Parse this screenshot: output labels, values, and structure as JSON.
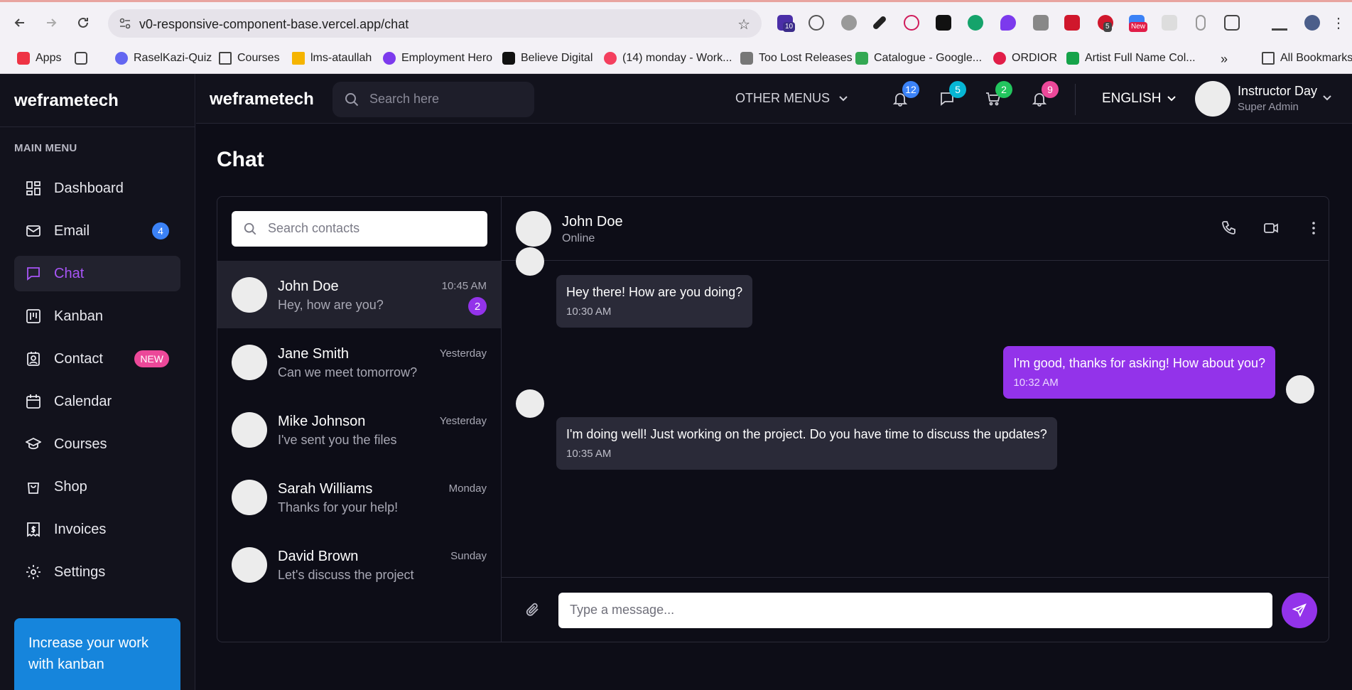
{
  "browser": {
    "url": "v0-responsive-component-base.vercel.app/chat",
    "extension_badges": [
      "10",
      "5",
      "New"
    ],
    "bookmarks": [
      "Apps",
      "RaselKazi-Quiz",
      "Courses",
      "lms-ataullah",
      "Employment Hero",
      "Believe Digital",
      "(14) monday - Work...",
      "Too Lost Releases",
      "Catalogue - Google...",
      "ORDIOR",
      "Artist Full Name Col..."
    ],
    "all_bookmarks": "All Bookmarks",
    "overflow": "»"
  },
  "sidebar": {
    "brand": "weframetech",
    "menu_title": "MAIN MENU",
    "items": [
      {
        "label": "Dashboard",
        "icon": "dashboard-icon"
      },
      {
        "label": "Email",
        "icon": "mail-icon",
        "badge": "4"
      },
      {
        "label": "Chat",
        "icon": "chat-icon",
        "active": true
      },
      {
        "label": "Kanban",
        "icon": "kanban-icon"
      },
      {
        "label": "Contact",
        "icon": "contact-icon",
        "tag": "NEW"
      },
      {
        "label": "Calendar",
        "icon": "calendar-icon"
      },
      {
        "label": "Courses",
        "icon": "graduation-cap-icon"
      },
      {
        "label": "Shop",
        "icon": "shopping-bag-icon"
      },
      {
        "label": "Invoices",
        "icon": "invoice-icon"
      },
      {
        "label": "Settings",
        "icon": "gear-icon"
      }
    ],
    "promo_text": "Increase your work with kanban"
  },
  "header": {
    "brand": "weframetech",
    "search_placeholder": "Search here",
    "other_menus": "OTHER MENUS",
    "badges": {
      "notifications": "12",
      "messages": "5",
      "cart": "2",
      "alerts": "9"
    },
    "badge_colors": {
      "notifications": "#3b82f6",
      "messages": "#06b6d4",
      "cart": "#22c55e",
      "alerts": "#ec4899"
    },
    "language": "ENGLISH",
    "user_name": "Instructor Day",
    "user_role": "Super Admin"
  },
  "page": {
    "title": "Chat"
  },
  "contacts": {
    "search_placeholder": "Search contacts",
    "list": [
      {
        "name": "John Doe",
        "message": "Hey, how are you?",
        "time": "10:45 AM",
        "unread": "2",
        "active": true
      },
      {
        "name": "Jane Smith",
        "message": "Can we meet tomorrow?",
        "time": "Yesterday"
      },
      {
        "name": "Mike Johnson",
        "message": "I've sent you the files",
        "time": "Yesterday"
      },
      {
        "name": "Sarah Williams",
        "message": "Thanks for your help!",
        "time": "Monday"
      },
      {
        "name": "David Brown",
        "message": "Let's discuss the project",
        "time": "Sunday"
      }
    ]
  },
  "conversation": {
    "name": "John Doe",
    "status": "Online",
    "messages": [
      {
        "text": "Hey there! How are you doing?",
        "time": "10:30 AM",
        "direction": "in"
      },
      {
        "text": "I'm good, thanks for asking! How about you?",
        "time": "10:32 AM",
        "direction": "out"
      },
      {
        "text": "I'm doing well! Just working on the project. Do you have time to discuss the updates?",
        "time": "10:35 AM",
        "direction": "in"
      }
    ],
    "composer_placeholder": "Type a message..."
  },
  "colors": {
    "accent": "#9333ea",
    "promo": "#1685dc",
    "background": "#0d0d17"
  }
}
